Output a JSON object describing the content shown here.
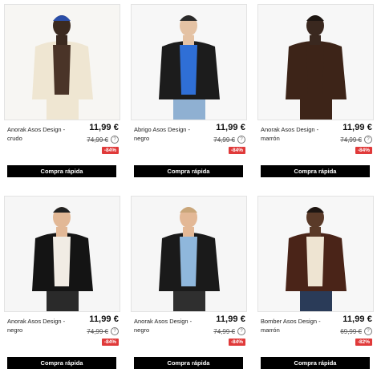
{
  "products": [
    {
      "name": "Anorak Asos Design - crudo",
      "price": "11,99 €",
      "old_price": "74,99 €",
      "discount": "-84%",
      "button": "Compra rápida",
      "colors": {
        "bg": "#f7f6f3",
        "coat": "#efe6d2",
        "inner": "#4a3428",
        "skin": "#3b2a20",
        "hat": "#2b4ea8",
        "legs": "#efe6d2"
      }
    },
    {
      "name": "Abrigo Asos Design - negro",
      "price": "11,99 €",
      "old_price": "74,99 €",
      "discount": "-84%",
      "button": "Compra rápida",
      "colors": {
        "bg": "#f7f7f7",
        "coat": "#1c1c1c",
        "inner": "#2f6fd6",
        "skin": "#e4c2a4",
        "hat": "#2a2a2a",
        "legs": "#8fb0d2"
      }
    },
    {
      "name": "Anorak Asos Design - marrón",
      "price": "11,99 €",
      "old_price": "74,99 €",
      "discount": "-84%",
      "button": "Compra rápida",
      "colors": {
        "bg": "#f7f7f7",
        "coat": "#3d2418",
        "inner": "#3d2418",
        "skin": "#3a281f",
        "hat": "#1e1612",
        "legs": "#3d2418"
      }
    },
    {
      "name": "Anorak Asos Design - negro",
      "price": "11,99 €",
      "old_price": "74,99 €",
      "discount": "-84%",
      "button": "Compra rápida",
      "colors": {
        "bg": "#f6f6f6",
        "coat": "#141414",
        "inner": "#f1ece4",
        "skin": "#e2b896",
        "hat": "#222222",
        "legs": "#2a2a2a"
      }
    },
    {
      "name": "Anorak Asos Design - negro",
      "price": "11,99 €",
      "old_price": "74,99 €",
      "discount": "-84%",
      "button": "Compra rápida",
      "colors": {
        "bg": "#f6f6f6",
        "coat": "#1a1a1a",
        "inner": "#8fb7dc",
        "skin": "#e3b896",
        "hat": "#c9a67a",
        "legs": "#2f2f2f"
      }
    },
    {
      "name": "Bomber Asos Design - marrón",
      "price": "11,99 €",
      "old_price": "69,99 €",
      "discount": "-82%",
      "button": "Compra rápida",
      "colors": {
        "bg": "#f7f7f7",
        "coat": "#4a2418",
        "inner": "#eee4d2",
        "skin": "#5a3a28",
        "hat": "#1e1612",
        "legs": "#2a3b58"
      }
    }
  ]
}
